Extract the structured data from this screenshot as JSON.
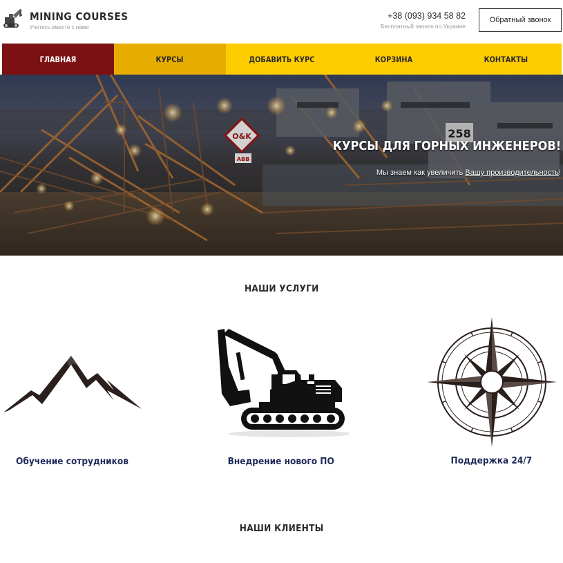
{
  "header": {
    "brand_title": "MINING COURSES",
    "brand_subtitle": "Учитесь вместе с нами",
    "phone": "+38 (093) 934 58 82",
    "phone_note": "Бесплатный звонок по Украине",
    "callback_label": "Обратный звонок",
    "logo_icon": "excavator-logo-icon"
  },
  "nav": {
    "items": [
      {
        "label": "ГЛАВНАЯ",
        "state": "active"
      },
      {
        "label": "КУРСЫ",
        "state": "hover"
      },
      {
        "label": "ДОБАВИТЬ КУРС",
        "state": "normal"
      },
      {
        "label": "КОРЗИНА",
        "state": "normal"
      },
      {
        "label": "КОНТАКТЫ",
        "state": "normal"
      }
    ]
  },
  "hero": {
    "title": "КУРСЫ ДЛЯ ГОРНЫХ ИНЖЕНЕРОВ!",
    "subtitle_part1": "Мы знаем как увеличить ",
    "subtitle_part2": "Вашу производительность",
    "subtitle_part3": "!",
    "sign_text": "O&K",
    "sign_text2": "ABB",
    "number_plate": "258"
  },
  "services": {
    "title": "НАШИ УСЛУГИ",
    "items": [
      {
        "label": "Обучение сотрудников",
        "icon": "mountains-icon"
      },
      {
        "label": "Внедрение нового ПО",
        "icon": "excavator-icon"
      },
      {
        "label": "Поддержка 24/7",
        "icon": "compass-rose-icon"
      }
    ]
  },
  "clients": {
    "title": "НАШИ КЛИЕНТЫ"
  },
  "colors": {
    "nav_yellow": "#ffcc00",
    "nav_active": "#7b1113",
    "nav_hover": "#e6ac00",
    "service_label": "#1f2a5a",
    "icon_dark": "#2a1f1c"
  }
}
